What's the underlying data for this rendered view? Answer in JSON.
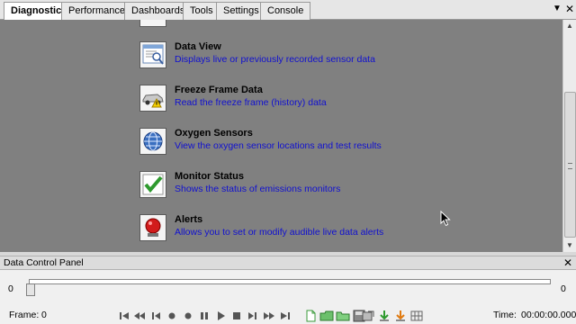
{
  "tabs": [
    {
      "label": "Diagnostics",
      "active": true
    },
    {
      "label": "Performance"
    },
    {
      "label": "Dashboards"
    },
    {
      "label": "Tools"
    },
    {
      "label": "Settings"
    },
    {
      "label": "Console"
    }
  ],
  "items": [
    {
      "title": "Data View",
      "description": "Displays live or previously recorded sensor data",
      "icon": "data-view-icon"
    },
    {
      "title": "Freeze Frame Data",
      "description": "Read the freeze frame (history) data",
      "icon": "car-warning-icon"
    },
    {
      "title": "Oxygen Sensors",
      "description": "View the oxygen sensor locations and test results",
      "icon": "globe-icon"
    },
    {
      "title": "Monitor Status",
      "description": "Shows the status of emissions monitors",
      "icon": "checkmark-icon"
    },
    {
      "title": "Alerts",
      "description": "Allows you to set or modify audible live data alerts",
      "icon": "alarm-icon"
    }
  ],
  "panel": {
    "title": "Data Control Panel",
    "slider_min": "0",
    "slider_max": "0",
    "slider_position": 0,
    "frame_label": "Frame:",
    "frame_value": "0",
    "time_label": "Time:",
    "time_value": "00:00:00.000"
  },
  "colors": {
    "content_bg": "#808080",
    "link": "#1010d0"
  }
}
